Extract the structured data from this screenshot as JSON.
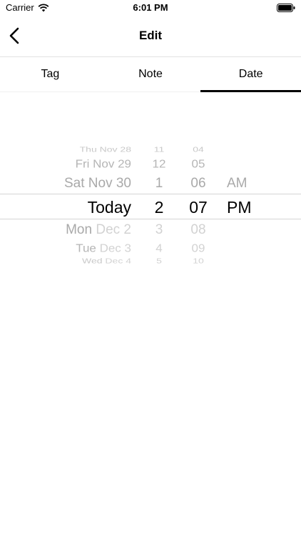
{
  "status_bar": {
    "carrier": "Carrier",
    "time": "6:01 PM"
  },
  "nav": {
    "title": "Edit"
  },
  "tabs": [
    {
      "label": "Tag",
      "active": false
    },
    {
      "label": "Note",
      "active": false
    },
    {
      "label": "Date",
      "active": true
    }
  ],
  "picker": {
    "days": [
      {
        "prefix": "",
        "suffix": ""
      },
      {
        "prefix": "Thu ",
        "suffix": "Nov 28"
      },
      {
        "prefix": "Fri ",
        "suffix": "Nov 29"
      },
      {
        "prefix": "Sat ",
        "suffix": "Nov 30"
      },
      {
        "prefix": "Today",
        "suffix": ""
      },
      {
        "prefix": "Mon ",
        "suffix": "Dec 2"
      },
      {
        "prefix": "Tue ",
        "suffix": "Dec 3"
      },
      {
        "prefix": "Wed ",
        "suffix": "Dec 4"
      },
      {
        "prefix": "",
        "suffix": ""
      }
    ],
    "hours": [
      "",
      "11",
      "12",
      "1",
      "2",
      "3",
      "4",
      "5",
      ""
    ],
    "minutes": [
      "",
      "04",
      "05",
      "06",
      "07",
      "08",
      "09",
      "10",
      ""
    ],
    "periods": [
      "",
      "",
      "",
      "AM",
      "PM",
      "",
      "",
      "",
      ""
    ],
    "selected": {
      "day": "Today",
      "hour": "2",
      "minute": "07",
      "period": "PM"
    }
  },
  "colors": {
    "selected_text": "#000000",
    "faded_text": "#a9a9a9",
    "tab_indicator": "#000000"
  },
  "icons": [
    "wifi-icon",
    "battery-icon",
    "back-chevron-icon"
  ]
}
